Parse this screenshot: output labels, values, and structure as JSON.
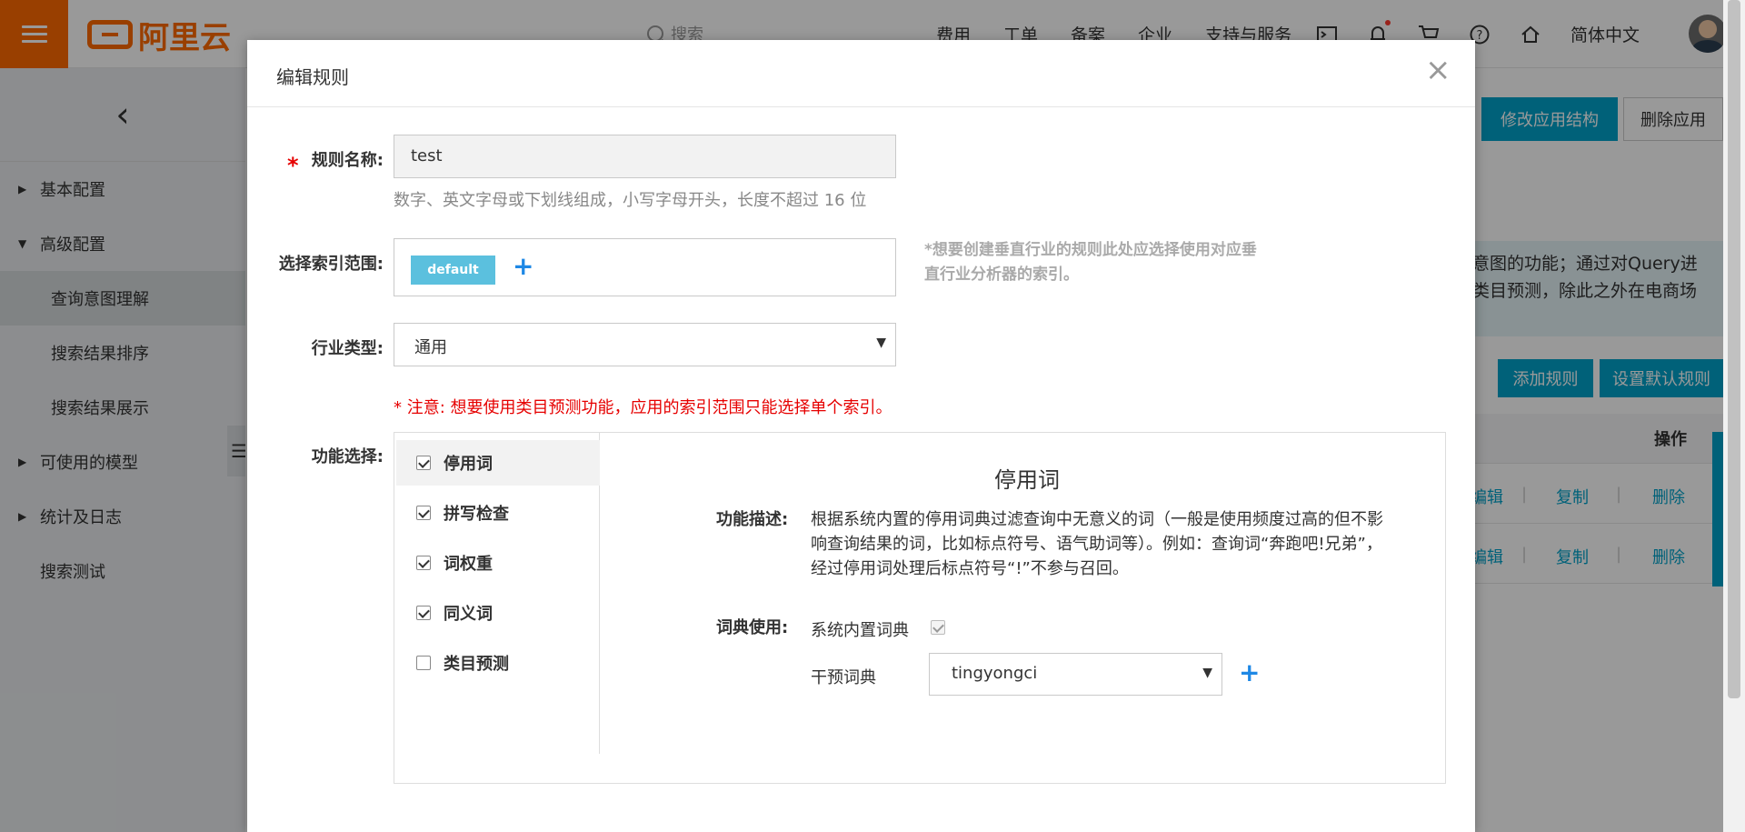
{
  "header": {
    "logo_text": "阿里云",
    "search_placeholder": "搜索",
    "nav": [
      "费用",
      "工单",
      "备案",
      "企业",
      "支持与服务"
    ],
    "lang": "简体中文"
  },
  "sidebar": {
    "items": [
      {
        "label": "基本配置",
        "expanded": false
      },
      {
        "label": "高级配置",
        "expanded": true
      }
    ],
    "subitems": [
      "查询意图理解",
      "搜索结果排序",
      "搜索结果展示"
    ],
    "items_after": [
      {
        "label": "可使用的模型"
      },
      {
        "label": "统计及日志"
      },
      {
        "label": "搜索测试"
      }
    ]
  },
  "main": {
    "modify_btn": "修改应用结构",
    "delete_btn": "删除应用",
    "banner_line1": "意图的功能；通过对Query进",
    "banner_line2": "类目预测，除此之外在电商场",
    "add_rule_btn": "添加规则",
    "set_default_btn": "设置默认规则",
    "col_action": "操作",
    "row_edit": "编辑",
    "row_copy": "复制",
    "row_delete": "删除"
  },
  "modal": {
    "title": "编辑规则",
    "rule_name_label": "规则名称:",
    "rule_name_value": "test",
    "rule_name_hint": "数字、英文字母或下划线组成，小写字母开头，长度不超过 16 位",
    "index_label": "选择索引范围:",
    "index_tag": "default",
    "index_note": "*想要创建垂直行业的规则此处应选择使用对应垂直行业分析器的索引。",
    "industry_label": "行业类型:",
    "industry_value": "通用",
    "warning": "* 注意: 想要使用类目预测功能，应用的索引范围只能选择单个索引。",
    "func_label": "功能选择:",
    "functions": [
      {
        "label": "停用词",
        "checked": true
      },
      {
        "label": "拼写检查",
        "checked": true
      },
      {
        "label": "词权重",
        "checked": true
      },
      {
        "label": "同义词",
        "checked": true
      },
      {
        "label": "类目预测",
        "checked": false
      }
    ],
    "detail": {
      "title": "停用词",
      "desc_label": "功能描述:",
      "desc": "根据系统内置的停用词典过滤查询中无意义的词（一般是使用频度过高的但不影响查询结果的词，比如标点符号、语气助词等）。例如：查询词“奔跑吧!兄弟”，经过停用词处理后标点符号“!”不参与召回。",
      "dict_label": "词典使用:",
      "builtin_dict": "系统内置词典",
      "intervene_dict": "干预词典",
      "intervene_value": "tingyongci"
    }
  },
  "colors": {
    "brand": "#ff6a00",
    "primary": "#00a2ca",
    "tag": "#5bc0de",
    "warning": "#e60000"
  }
}
